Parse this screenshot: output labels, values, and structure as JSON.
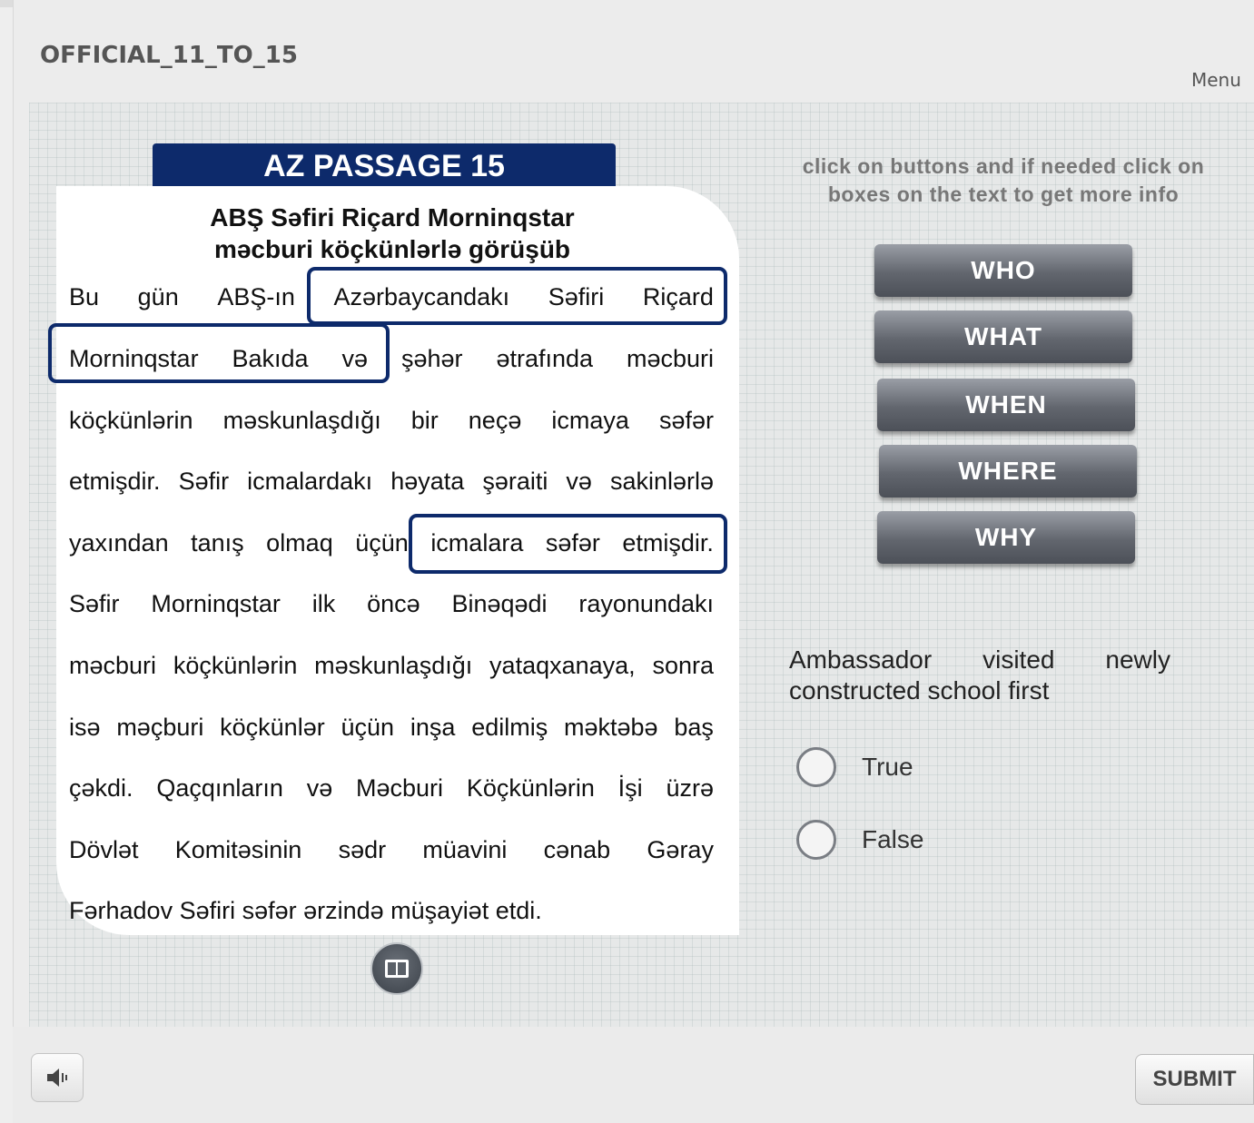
{
  "header": {
    "course_title": "OFFICIAL_11_TO_15",
    "menu_label": "Menu"
  },
  "passage": {
    "banner": "AZ PASSAGE 15",
    "headline_line1": "ABŞ Səfiri Riçard Morninqstar",
    "headline_line2": "məcburi köçkünlərlə görüşüb",
    "lines": [
      [
        "Bu",
        "gün",
        "ABŞ-ın",
        "Azərbaycandakı",
        "Səfiri",
        "Riçard"
      ],
      [
        "Morninqstar",
        "Bakıda",
        "və",
        "şəhər",
        "ətrafında",
        "məcburi"
      ],
      [
        "köçkünlərin",
        "məskunlaşdığı",
        "bir",
        "neçə",
        "icmaya",
        "səfər"
      ],
      [
        "etmişdir.",
        "Səfir",
        "icmalardakı",
        "həyata",
        "şəraiti",
        "və",
        "sakinlərlə"
      ],
      [
        "yaxından",
        "tanış",
        "olmaq",
        "üçün",
        "icmalara",
        "səfər",
        "etmişdir."
      ],
      [
        "Səfir",
        "Morninqstar",
        "ilk",
        "öncə",
        "Binəqədi",
        "rayonundakı"
      ],
      [
        "məcburi",
        "köçkünlərin",
        "məskunlaşdığı",
        "yataqxanaya,",
        "sonra"
      ],
      [
        "isə",
        "məçburi",
        "köçkünlər",
        "üçün",
        "inşa",
        "edilmiş",
        "məktəbə",
        "baş"
      ],
      [
        "çəkdi.",
        "Qaçqınların",
        "və",
        "Məcburi",
        "Köçkünlərin",
        "İşi",
        "üzrə"
      ],
      [
        "Dövlət",
        "Komitəsinin",
        "sədr",
        "müavini",
        "cənab",
        "Gəray"
      ],
      [
        "Fərhadov Səfiri səfər ərzində müşayiət etdi."
      ]
    ]
  },
  "instruction_text": "click on buttons and if needed click on boxes on the text to get more info",
  "wh_buttons": [
    "WHO",
    "WHAT",
    "WHEN",
    "WHERE",
    "WHY"
  ],
  "quiz": {
    "question": "Ambassador visited newly constructed school first",
    "options": [
      "True",
      "False"
    ]
  },
  "footer": {
    "submit_label": "SUBMIT",
    "audio_icon": "speaker-icon"
  },
  "colors": {
    "navy": "#0d2a6b",
    "button_gray": "#62666e"
  }
}
